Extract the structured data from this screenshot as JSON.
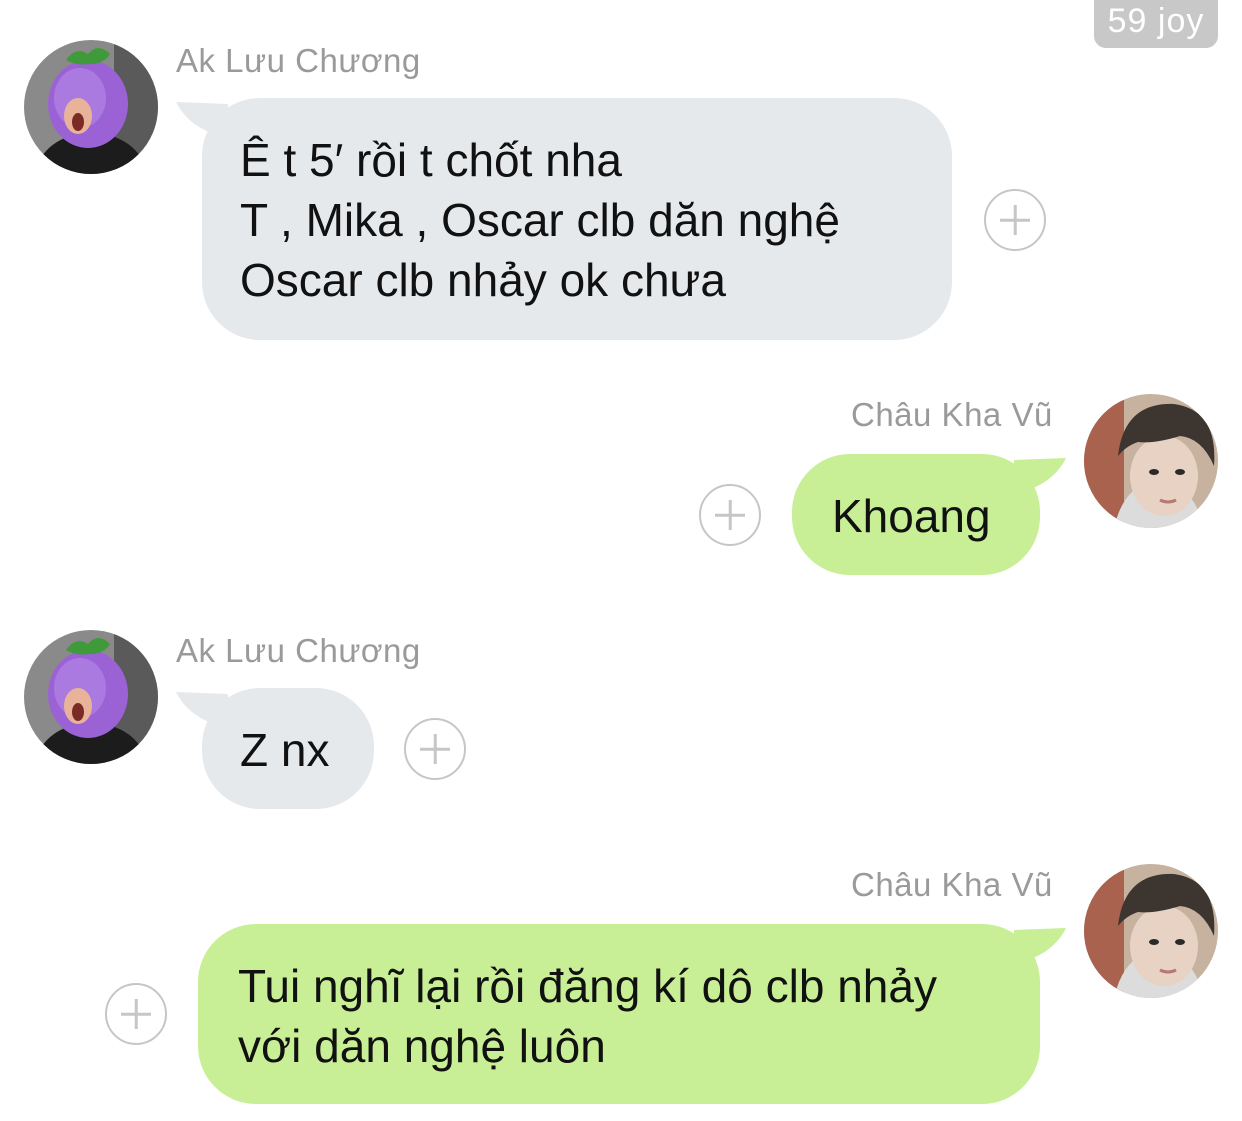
{
  "header": {
    "badge": "59 joy"
  },
  "colors": {
    "incoming_bubble": "#e6e9ec",
    "outgoing_bubble": "#c8ef96",
    "sender_name": "#9a9a9a",
    "add_reaction_icon": "#c6c6c6"
  },
  "messages": [
    {
      "sender": "Ak Lưu Chương",
      "direction": "incoming",
      "lines": [
        "Ê t 5′ rồi t chốt nha",
        "T ,  Mika , Oscar clb dăn nghệ",
        "Oscar clb nhảy ok chưa"
      ],
      "avatar_icon": "eggplant-hat-avatar",
      "action_icon": "add-reaction-icon"
    },
    {
      "sender": "Châu Kha Vũ",
      "direction": "outgoing",
      "lines": [
        "Khoang"
      ],
      "avatar_icon": "selfie-avatar",
      "action_icon": "add-reaction-icon"
    },
    {
      "sender": "Ak Lưu Chương",
      "direction": "incoming",
      "lines": [
        "Z nx"
      ],
      "avatar_icon": "eggplant-hat-avatar",
      "action_icon": "add-reaction-icon"
    },
    {
      "sender": "Châu Kha Vũ",
      "direction": "outgoing",
      "lines": [
        "Tui nghĩ lại rồi đăng kí dô clb nhảy",
        "với dăn nghệ luôn"
      ],
      "avatar_icon": "selfie-avatar",
      "action_icon": "add-reaction-icon"
    }
  ]
}
